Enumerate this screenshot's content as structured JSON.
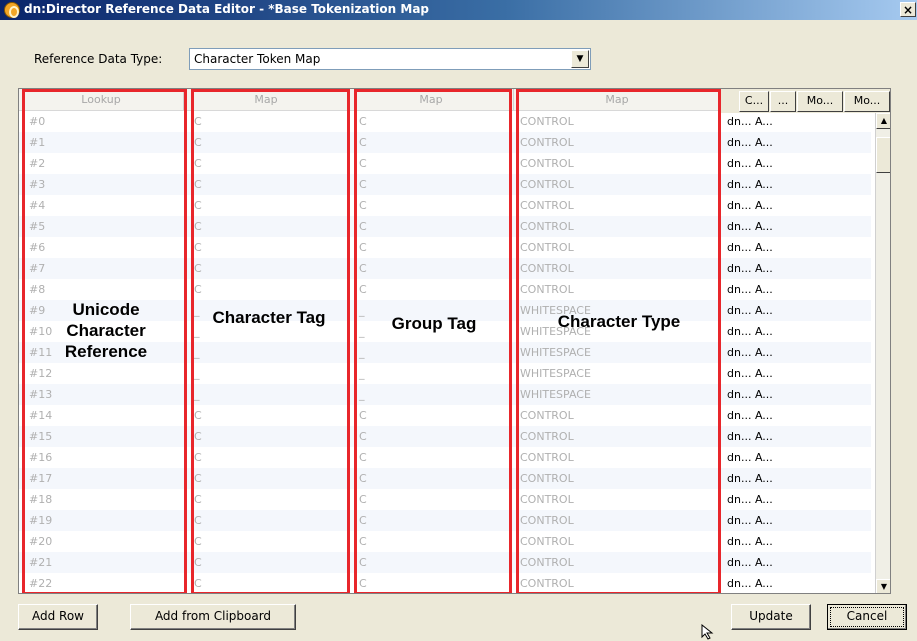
{
  "window": {
    "title": "dn:Director Reference Data Editor - *Base Tokenization Map",
    "close_label": "×",
    "app_icon": "app-logo-icon"
  },
  "reference_data_type": {
    "label": "Reference Data Type:",
    "value": "Character Token Map"
  },
  "grid": {
    "columns": [
      {
        "label": "Lookup"
      },
      {
        "label": "Map"
      },
      {
        "label": "Map"
      },
      {
        "label": "Map"
      }
    ],
    "right_columns": [
      "C...",
      "...",
      "Mo...",
      "Mo..."
    ],
    "rows": [
      {
        "lookup": "#0",
        "tag": "C",
        "group": "C",
        "type": "CONTROL",
        "extra": "dn... A..."
      },
      {
        "lookup": "#1",
        "tag": "C",
        "group": "C",
        "type": "CONTROL",
        "extra": "dn... A..."
      },
      {
        "lookup": "#2",
        "tag": "C",
        "group": "C",
        "type": "CONTROL",
        "extra": "dn... A..."
      },
      {
        "lookup": "#3",
        "tag": "C",
        "group": "C",
        "type": "CONTROL",
        "extra": "dn... A..."
      },
      {
        "lookup": "#4",
        "tag": "C",
        "group": "C",
        "type": "CONTROL",
        "extra": "dn... A..."
      },
      {
        "lookup": "#5",
        "tag": "C",
        "group": "C",
        "type": "CONTROL",
        "extra": "dn... A..."
      },
      {
        "lookup": "#6",
        "tag": "C",
        "group": "C",
        "type": "CONTROL",
        "extra": "dn... A..."
      },
      {
        "lookup": "#7",
        "tag": "C",
        "group": "C",
        "type": "CONTROL",
        "extra": "dn... A..."
      },
      {
        "lookup": "#8",
        "tag": "C",
        "group": "C",
        "type": "CONTROL",
        "extra": "dn... A..."
      },
      {
        "lookup": "#9",
        "tag": "_",
        "group": "_",
        "type": "WHITESPACE",
        "extra": "dn... A..."
      },
      {
        "lookup": "#10",
        "tag": "_",
        "group": "_",
        "type": "WHITESPACE",
        "extra": "dn... A..."
      },
      {
        "lookup": "#11",
        "tag": "_",
        "group": "_",
        "type": "WHITESPACE",
        "extra": "dn... A..."
      },
      {
        "lookup": "#12",
        "tag": "_",
        "group": "_",
        "type": "WHITESPACE",
        "extra": "dn... A..."
      },
      {
        "lookup": "#13",
        "tag": "_",
        "group": "_",
        "type": "WHITESPACE",
        "extra": "dn... A..."
      },
      {
        "lookup": "#14",
        "tag": "C",
        "group": "C",
        "type": "CONTROL",
        "extra": "dn... A..."
      },
      {
        "lookup": "#15",
        "tag": "C",
        "group": "C",
        "type": "CONTROL",
        "extra": "dn... A..."
      },
      {
        "lookup": "#16",
        "tag": "C",
        "group": "C",
        "type": "CONTROL",
        "extra": "dn... A..."
      },
      {
        "lookup": "#17",
        "tag": "C",
        "group": "C",
        "type": "CONTROL",
        "extra": "dn... A..."
      },
      {
        "lookup": "#18",
        "tag": "C",
        "group": "C",
        "type": "CONTROL",
        "extra": "dn... A..."
      },
      {
        "lookup": "#19",
        "tag": "C",
        "group": "C",
        "type": "CONTROL",
        "extra": "dn... A..."
      },
      {
        "lookup": "#20",
        "tag": "C",
        "group": "C",
        "type": "CONTROL",
        "extra": "dn... A..."
      },
      {
        "lookup": "#21",
        "tag": "C",
        "group": "C",
        "type": "CONTROL",
        "extra": "dn... A..."
      },
      {
        "lookup": "#22",
        "tag": "C",
        "group": "C",
        "type": "CONTROL",
        "extra": "dn... A..."
      }
    ]
  },
  "annotations": {
    "lookup": "Unicode Character Reference",
    "tag": "Character Tag",
    "group": "Group Tag",
    "type": "Character Type",
    "highlight_color": "#e8262b"
  },
  "buttons": {
    "add_row": "Add Row",
    "add_clipboard": "Add from Clipboard",
    "update": "Update",
    "cancel": "Cancel"
  }
}
